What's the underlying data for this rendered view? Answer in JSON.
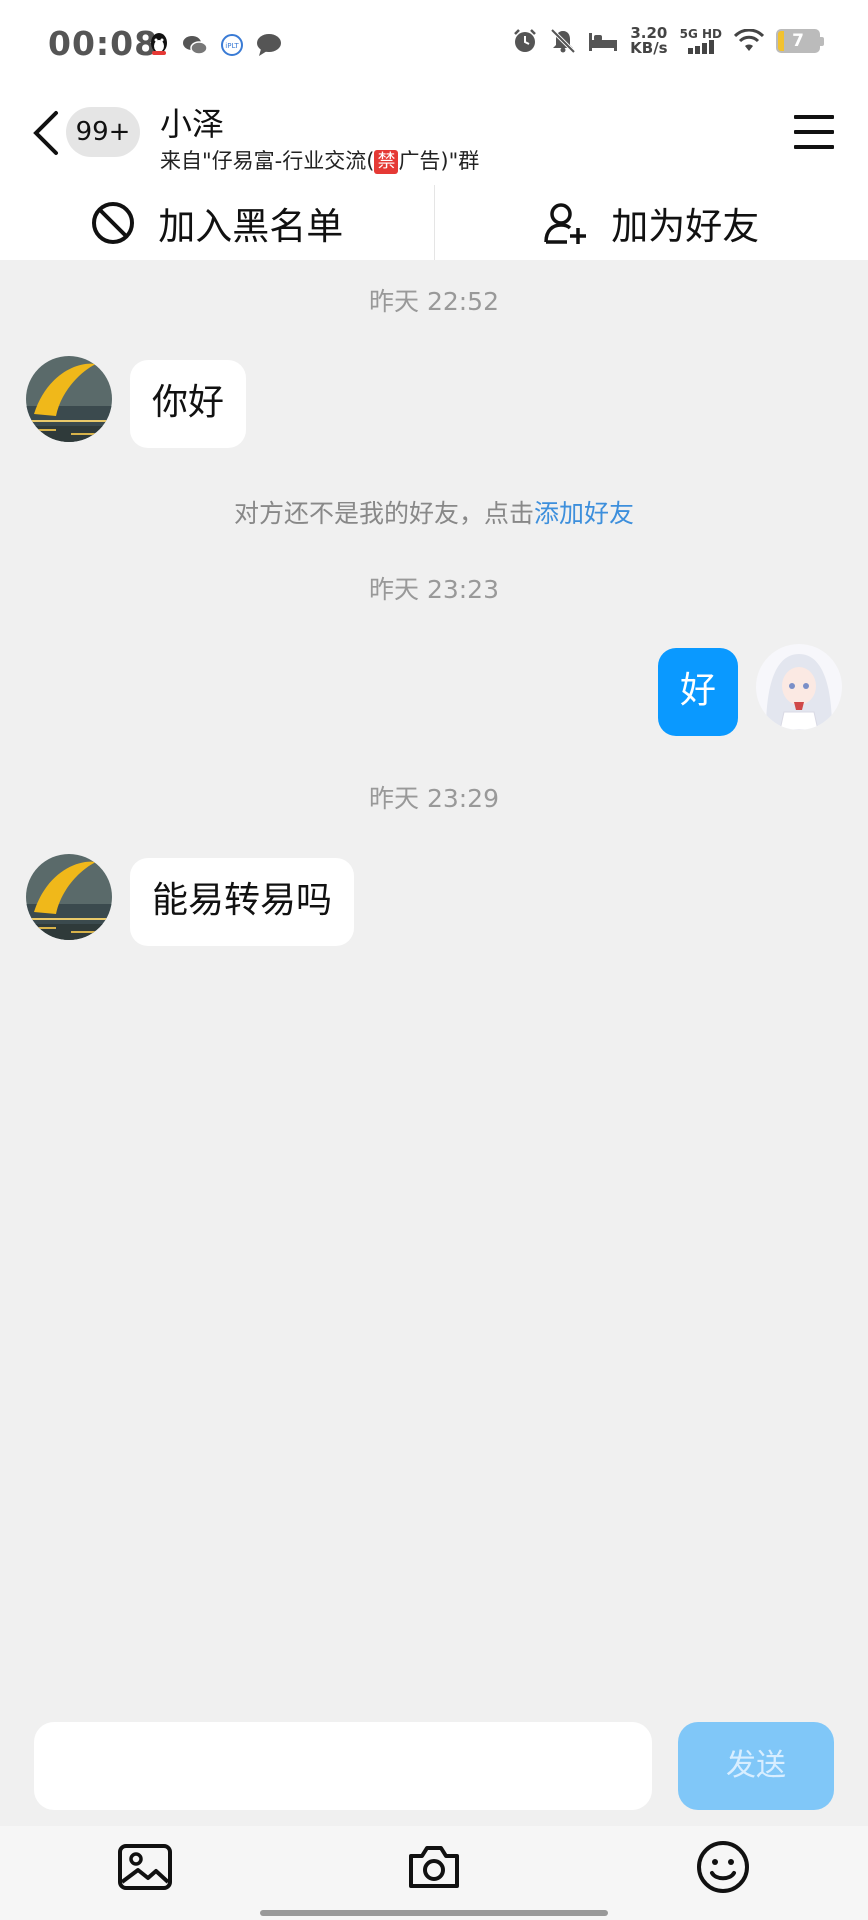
{
  "status_bar": {
    "time": "00:08",
    "speed_value": "3.20",
    "speed_unit": "KB/s",
    "network_label": "5G HD",
    "battery_level": "7",
    "notification_icons": [
      "qq-icon",
      "wechat-icon",
      "app-icon",
      "message-icon"
    ],
    "system_icons": [
      "alarm-icon",
      "mute-icon",
      "bed-icon",
      "signal-icon",
      "wifi-icon",
      "battery-icon"
    ]
  },
  "header": {
    "unread_count": "99+",
    "contact_name": "小泽",
    "source_prefix": "来自\"仔易富-行业交流(",
    "source_ban_tag": "禁",
    "source_suffix": "广告)\"群"
  },
  "actions": {
    "blacklist_label": "加入黑名单",
    "add_friend_label": "加为好友"
  },
  "messages": [
    {
      "type": "timestamp",
      "text": "昨天 22:52"
    },
    {
      "type": "incoming",
      "text": "你好"
    },
    {
      "type": "system",
      "text": "对方还不是我的好友，点击",
      "link": "添加好友"
    },
    {
      "type": "timestamp",
      "text": "昨天 23:23"
    },
    {
      "type": "outgoing",
      "text": "好"
    },
    {
      "type": "timestamp",
      "text": "昨天 23:29"
    },
    {
      "type": "incoming",
      "text": "能易转易吗"
    }
  ],
  "composer": {
    "input_value": "",
    "send_label": "发送"
  },
  "toolbar": [
    "image-icon",
    "camera-icon",
    "emoji-icon"
  ],
  "colors": {
    "accent": "#0a99ff",
    "send_disabled": "#80c7f8",
    "link": "#3d8fdc",
    "background": "#f0f0f0"
  }
}
